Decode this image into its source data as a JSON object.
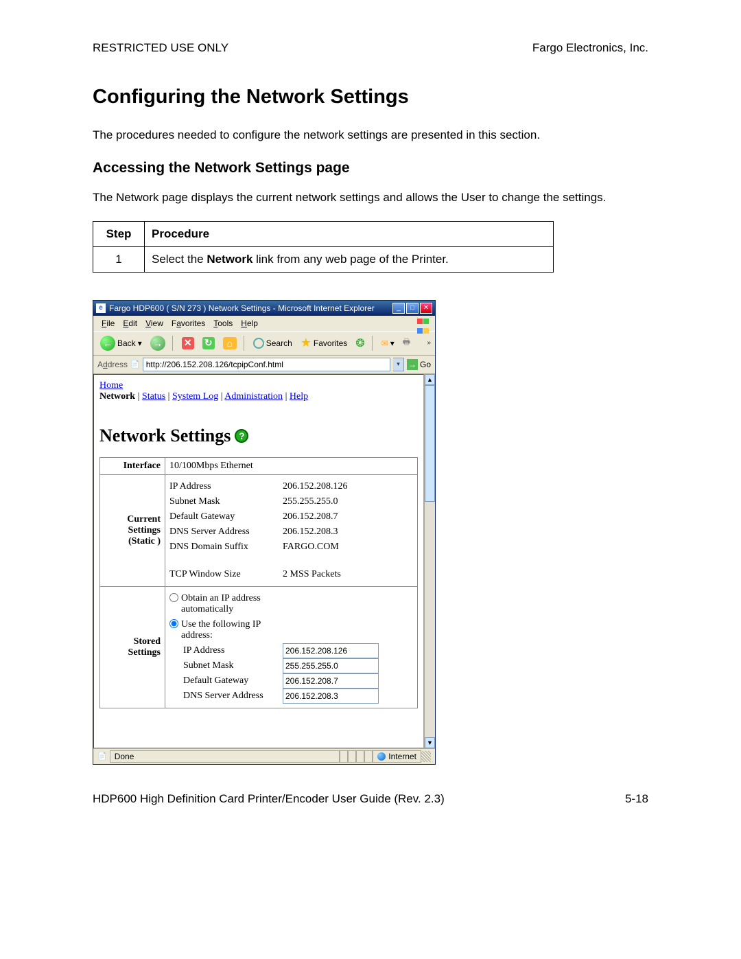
{
  "header": {
    "left": "RESTRICTED USE ONLY",
    "right": "Fargo Electronics, Inc."
  },
  "h1": "Configuring the Network Settings",
  "intro": "The procedures needed to configure the network settings are presented in this section.",
  "h2": "Accessing the Network Settings page",
  "para": "The Network page displays the current network settings and allows the User to change the settings.",
  "table": {
    "head_step": "Step",
    "head_proc": "Procedure",
    "step1_num": "1",
    "step1_pre": "Select the ",
    "step1_bold": "Network",
    "step1_post": " link from any web page of the Printer."
  },
  "ie": {
    "title": "Fargo HDP600 ( S/N 273 ) Network Settings - Microsoft Internet Explorer",
    "menu": {
      "file": "File",
      "edit": "Edit",
      "view": "View",
      "favorites": "Favorites",
      "tools": "Tools",
      "help": "Help"
    },
    "toolbar": {
      "back": "Back",
      "search": "Search",
      "favorites": "Favorites"
    },
    "addrlabel": "Address",
    "url": "http://206.152.208.126/tcpipConf.html",
    "go": "Go",
    "nav": {
      "home": "Home",
      "network": "Network",
      "status": "Status",
      "system_log": "System Log",
      "administration": "Administration",
      "help": "Help"
    },
    "page_title": "Network Settings",
    "rows": {
      "interface_label": "Interface",
      "interface_value": "10/100Mbps Ethernet",
      "current_label": "Current Settings (Static )",
      "stored_label": "Stored Settings"
    },
    "current": {
      "ip_label": "IP Address",
      "ip_value": "206.152.208.126",
      "mask_label": "Subnet Mask",
      "mask_value": "255.255.255.0",
      "gw_label": "Default Gateway",
      "gw_value": "206.152.208.7",
      "dns_label": "DNS Server Address",
      "dns_value": "206.152.208.3",
      "suffix_label": "DNS Domain Suffix",
      "suffix_value": "FARGO.COM",
      "tcp_label": "TCP Window Size",
      "tcp_value": "2 MSS Packets"
    },
    "stored": {
      "radio_auto": "Obtain an IP address automatically",
      "radio_manual": "Use the following IP address:",
      "ip_label": "IP Address",
      "ip_value": "206.152.208.126",
      "mask_label": "Subnet Mask",
      "mask_value": "255.255.255.0",
      "gw_label": "Default Gateway",
      "gw_value": "206.152.208.7",
      "dns_label": "DNS Server Address",
      "dns_value": "206.152.208.3"
    },
    "status": {
      "done": "Done",
      "zone": "Internet"
    }
  },
  "footer": {
    "left": "HDP600 High Definition Card Printer/Encoder User Guide (Rev. 2.3)",
    "right": "5-18"
  }
}
